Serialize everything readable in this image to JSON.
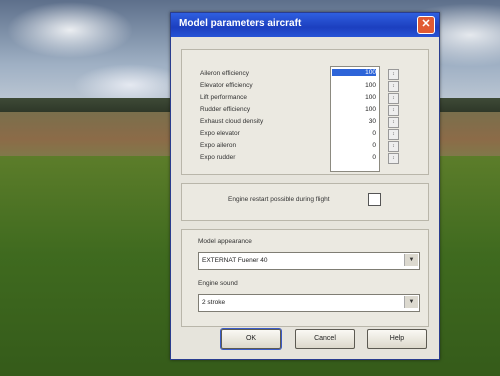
{
  "dialog": {
    "title": "Model parameters aircraft",
    "close_glyph": "✕",
    "parameters": [
      {
        "label": "Aileron efficiency",
        "value": "100"
      },
      {
        "label": "Elevator efficiency",
        "value": "100"
      },
      {
        "label": "Lift performance",
        "value": "100"
      },
      {
        "label": "Rudder efficiency",
        "value": "100"
      },
      {
        "label": "Exhaust cloud density",
        "value": "30"
      },
      {
        "label": "Expo elevator",
        "value": "0"
      },
      {
        "label": "Expo aileron",
        "value": "0"
      },
      {
        "label": "Expo rudder",
        "value": "0"
      }
    ],
    "restart_label": "Engine restart possible during flight",
    "model_appearance_label": "Model appearance",
    "model_appearance_value": "EXTERNAT Fuener 40",
    "engine_sound_label": "Engine sound",
    "engine_sound_value": "2 stroke",
    "ok_label": "OK",
    "cancel_label": "Cancel",
    "help_label": "Help"
  }
}
